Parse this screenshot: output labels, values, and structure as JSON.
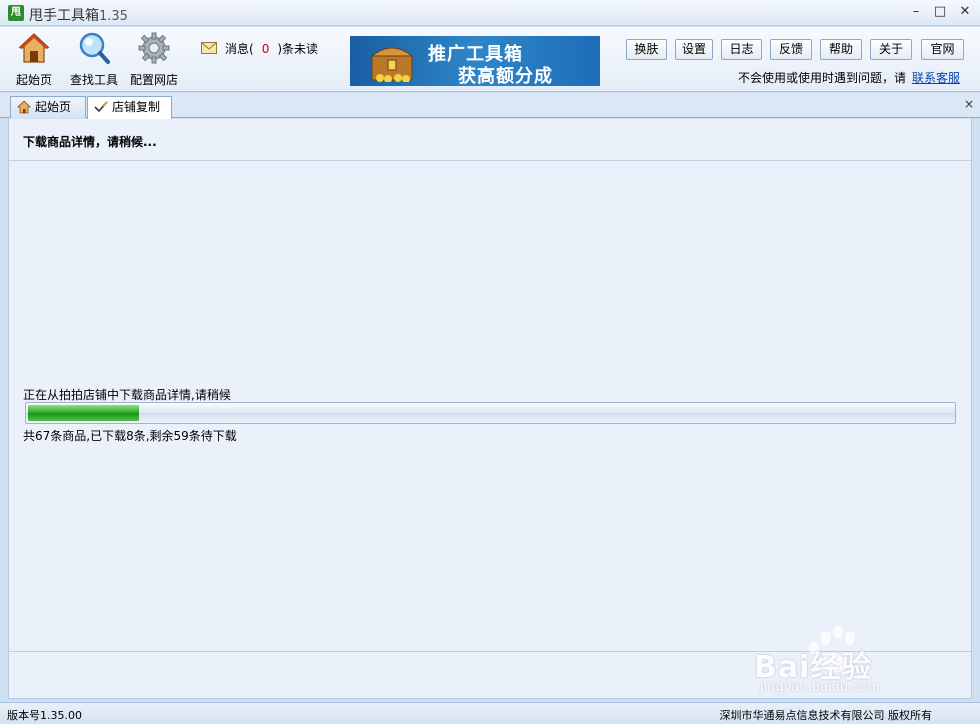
{
  "window": {
    "logo_text": "甩",
    "title": "甩手工具箱",
    "version": "1.35",
    "controls": {
      "minimize": "–",
      "maximize": "□",
      "close": "✕"
    }
  },
  "toolbar": {
    "tools": [
      {
        "label": "起始页",
        "icon": "home-icon"
      },
      {
        "label": "查找工具",
        "icon": "magnifier-icon"
      },
      {
        "label": "配置网店",
        "icon": "gear-icon"
      }
    ],
    "message": {
      "prefix": "消息(",
      "count": "0",
      "suffix": ")条未读",
      "icon": "envelope-icon"
    },
    "banner": {
      "line1": "推广工具箱",
      "line2": "获高额分成",
      "icon": "treasure-chest-icon"
    },
    "buttons": [
      "换肤",
      "设置",
      "日志",
      "反馈",
      "帮助",
      "关于",
      "官网"
    ],
    "help_text": "不会使用或使用时遇到问题，请",
    "help_link": "联系客服"
  },
  "tabs": [
    {
      "label": "起始页",
      "icon": "home-icon",
      "active": false
    },
    {
      "label": "店铺复制",
      "icon": "checkmark-pen-icon",
      "active": true
    }
  ],
  "tab_close": "×",
  "content": {
    "heading": "下载商品详情，请稍候...",
    "progress_label": "正在从拍拍店铺中下载商品详情,请稍候",
    "progress": {
      "downloaded": 8,
      "total": 67
    },
    "progress_sub": "共67条商品,已下载8条,剩余59条待下载"
  },
  "status": {
    "version": "版本号1.35.00",
    "copyright": "深圳市华通易点信息技术有限公司 版权所有"
  },
  "watermark": {
    "brand": "Bai经验",
    "url": "jingyan.baidu.com"
  },
  "colors": {
    "accent_green": "#1c921b",
    "link_blue": "#0645ad",
    "count_red": "#cc0000",
    "banner_blue": "#2e86c9"
  }
}
